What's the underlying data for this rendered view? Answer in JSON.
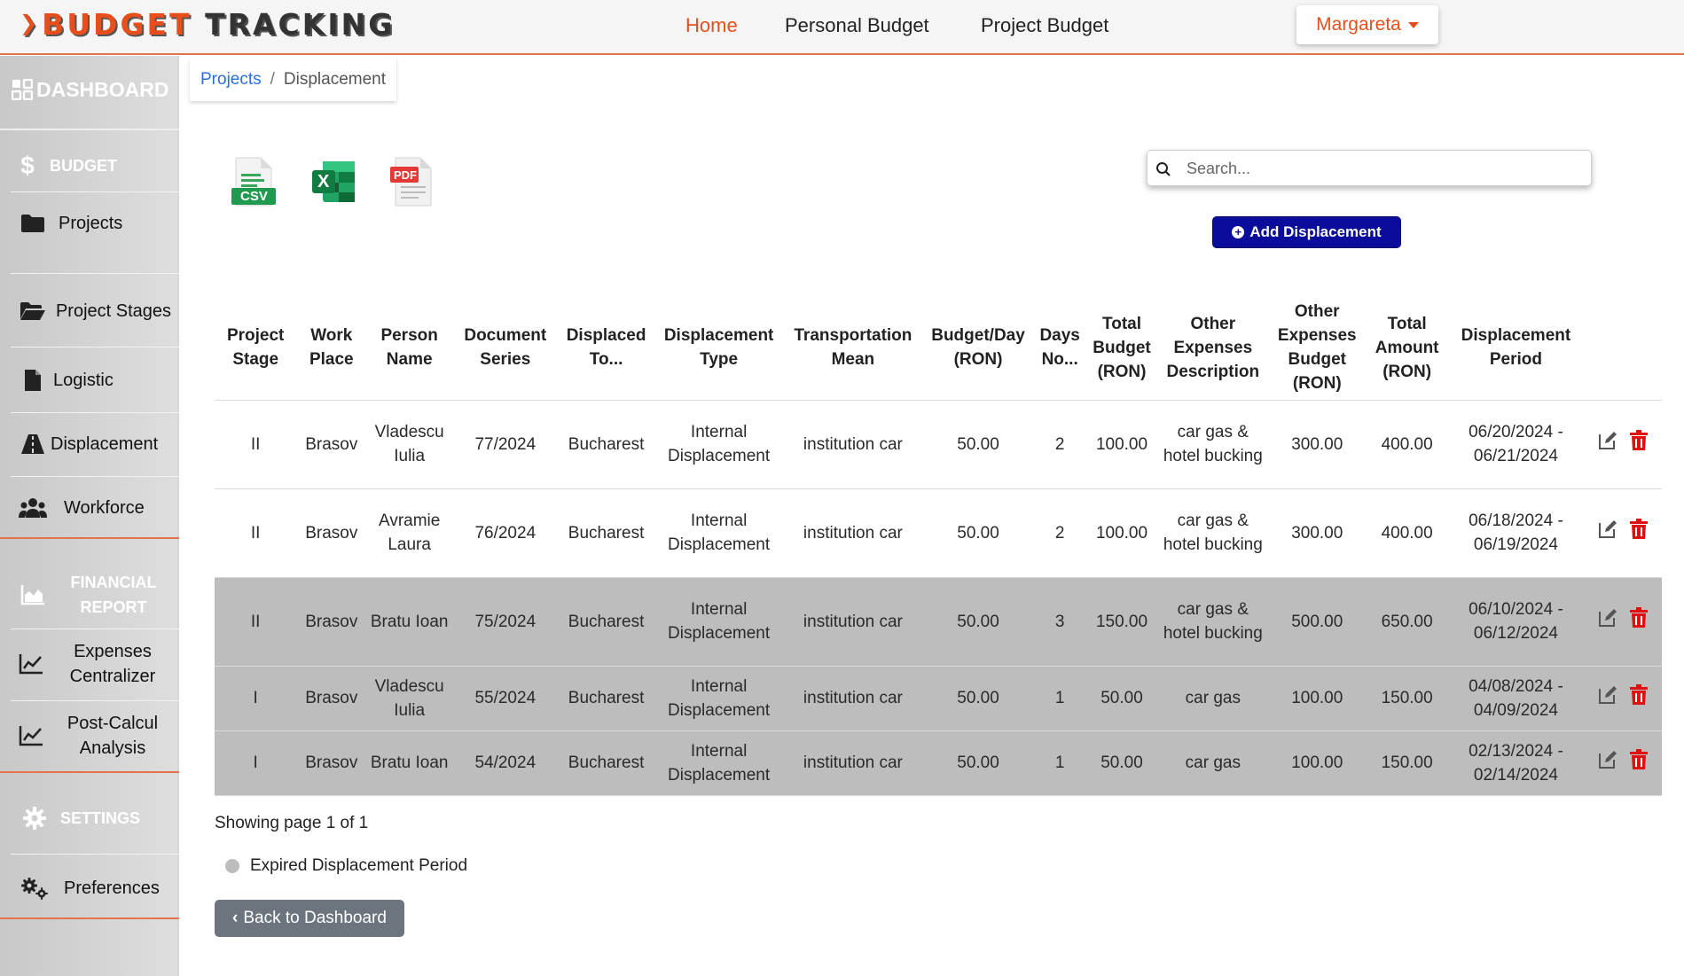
{
  "brand": {
    "part1": "BUDGET",
    "part2": "TRACKING"
  },
  "nav": {
    "home": "Home",
    "personal_budget": "Personal Budget",
    "project_budget": "Project Budget",
    "user": "Margareta"
  },
  "colors": {
    "accent": "#e84e1b",
    "primary_button": "#0a0d9c",
    "expired_row": "#bdbdbd",
    "delete": "#e01010",
    "link": "#2a6fdb"
  },
  "sidebar": {
    "dashboard": "DASHBOARD",
    "budget_header": "BUDGET",
    "projects": "Projects",
    "project_stages": "Project Stages",
    "logistic": "Logistic",
    "displacement": "Displacement",
    "workforce": "Workforce",
    "financial_header": "FINANCIAL REPORT",
    "expenses_centralizer": "Expenses Centralizer",
    "post_calcul": "Post-Calcul Analysis",
    "settings_header": "SETTINGS",
    "preferences": "Preferences"
  },
  "breadcrumb": {
    "parent": "Projects",
    "separator": "/",
    "current": "Displacement"
  },
  "export": {
    "csv": "CSV",
    "excel": "X",
    "pdf": "PDF"
  },
  "search": {
    "placeholder": "Search..."
  },
  "add_button": "Add Displacement",
  "table": {
    "headers": [
      "Project Stage",
      "Work Place",
      "Person Name",
      "Document Series",
      "Displaced To...",
      "Displacement Type",
      "Transportation Mean",
      "Budget/Day (RON)",
      "Days No...",
      "Total Budget (RON)",
      "Other Expenses Description",
      "Other Expenses Budget (RON)",
      "Total Amount (RON)",
      "Displacement Period"
    ],
    "rows": [
      [
        "II",
        "Brasov",
        "Vladescu Iulia",
        "77/2024",
        "Bucharest",
        "Internal Displacement",
        "institution car",
        "50.00",
        "2",
        "100.00",
        "car gas & hotel bucking",
        "300.00",
        "400.00",
        "06/20/2024 - 06/21/2024"
      ],
      [
        "II",
        "Brasov",
        "Avramie Laura",
        "76/2024",
        "Bucharest",
        "Internal Displacement",
        "institution car",
        "50.00",
        "2",
        "100.00",
        "car gas & hotel bucking",
        "300.00",
        "400.00",
        "06/18/2024 - 06/19/2024"
      ],
      [
        "II",
        "Brasov",
        "Bratu Ioan",
        "75/2024",
        "Bucharest",
        "Internal Displacement",
        "institution car",
        "50.00",
        "3",
        "150.00",
        "car gas & hotel bucking",
        "500.00",
        "650.00",
        "06/10/2024 - 06/12/2024"
      ],
      [
        "I",
        "Brasov",
        "Vladescu Iulia",
        "55/2024",
        "Bucharest",
        "Internal Displacement",
        "institution car",
        "50.00",
        "1",
        "50.00",
        "car gas",
        "100.00",
        "150.00",
        "04/08/2024 - 04/09/2024"
      ],
      [
        "I",
        "Brasov",
        "Bratu Ioan",
        "54/2024",
        "Bucharest",
        "Internal Displacement",
        "institution car",
        "50.00",
        "1",
        "50.00",
        "car gas",
        "100.00",
        "150.00",
        "02/13/2024 - 02/14/2024"
      ]
    ],
    "expired": [
      false,
      false,
      true,
      true,
      true
    ]
  },
  "pagination": "Showing page 1 of 1",
  "legend": "Expired Displacement Period",
  "back_button": "Back to Dashboard"
}
